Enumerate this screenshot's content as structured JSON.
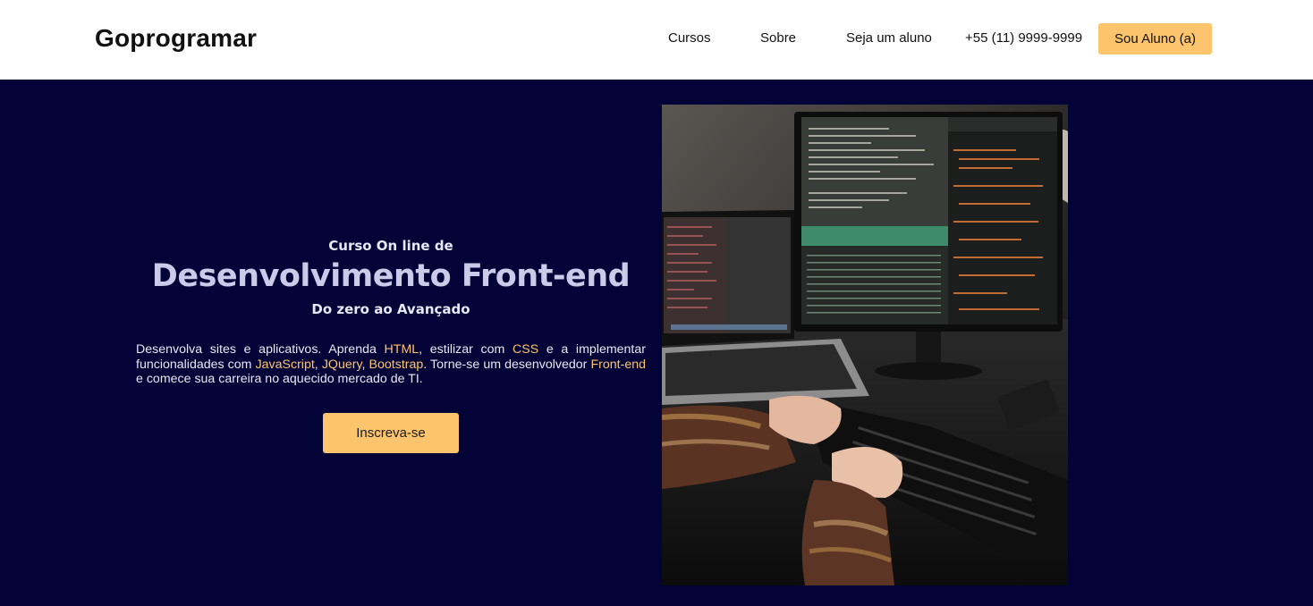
{
  "header": {
    "logo": "Goprogramar",
    "nav": [
      {
        "label": "Cursos"
      },
      {
        "label": "Sobre"
      },
      {
        "label": "Seja um aluno"
      },
      {
        "label": "+55 (11) 9999-9999"
      }
    ],
    "cta_label": "Sou Aluno (a)"
  },
  "hero": {
    "kicker": "Curso On line de",
    "title": "Desenvolvimento Front-end",
    "subtitle": "Do zero ao Avançado",
    "description": {
      "p1": "Desenvolva sites e aplicativos. Aprenda ",
      "hl1": "HTML",
      "p2": ", estilizar com ",
      "hl2": "CSS",
      "p3": " e a implementar funcionalidades com ",
      "hl3": "JavaScript",
      "p4": ", ",
      "hl4": "JQuery",
      "p5": ", ",
      "hl5": "Bootstrap",
      "p6": ". Torne-se um desenvolvedor ",
      "hl6": "Front-end",
      "p7": " e comece sua carreira no aquecido mercado de TI."
    },
    "cta_label": "Inscreva-se"
  },
  "colors": {
    "accent": "#fcc46c",
    "hero_background": "#030338"
  }
}
